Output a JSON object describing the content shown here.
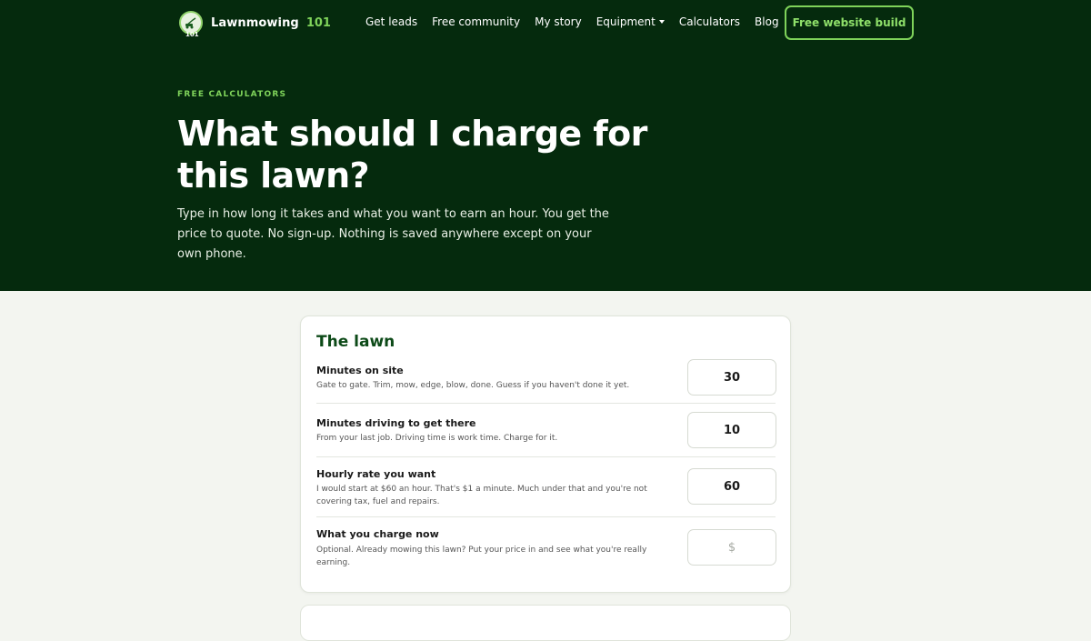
{
  "nav": {
    "brand": "Lawnmowing",
    "brand_number": "101",
    "logo_badge_number": "101",
    "links": [
      "Get leads",
      "Free community",
      "My story",
      "Equipment",
      "Calculators",
      "Blog"
    ],
    "cta": "Free website build"
  },
  "hero": {
    "eyebrow": "FREE CALCULATORS",
    "headline": "What should I charge for this lawn?",
    "subtext": "Type in how long it takes and what you want to earn an hour. You get the price to quote. No sign-up. Nothing is saved anywhere except on your own phone."
  },
  "card": {
    "title": "The lawn",
    "rows": [
      {
        "label": "Minutes on site",
        "help": "Gate to gate. Trim, mow, edge, blow, done. Guess if you haven't done it yet.",
        "value": "30",
        "placeholder": ""
      },
      {
        "label": "Minutes driving to get there",
        "help": "From your last job. Driving time is work time. Charge for it.",
        "value": "10",
        "placeholder": ""
      },
      {
        "label": "Hourly rate you want",
        "help": "I would start at $60 an hour. That's $1 a minute. Much under that and you're not covering tax, fuel and repairs.",
        "value": "60",
        "placeholder": ""
      },
      {
        "label": "What you charge now",
        "help": "Optional. Already mowing this lawn? Put your price in and see what you're really earning.",
        "value": "",
        "placeholder": "$"
      }
    ]
  },
  "colors": {
    "hero_bg": "#052a0d",
    "accent": "#7fd35a",
    "page_bg": "#f3f5f0",
    "card_title": "#0d4a18"
  },
  "icons": [
    "lawnmower-logo-icon",
    "chevron-down-icon"
  ]
}
